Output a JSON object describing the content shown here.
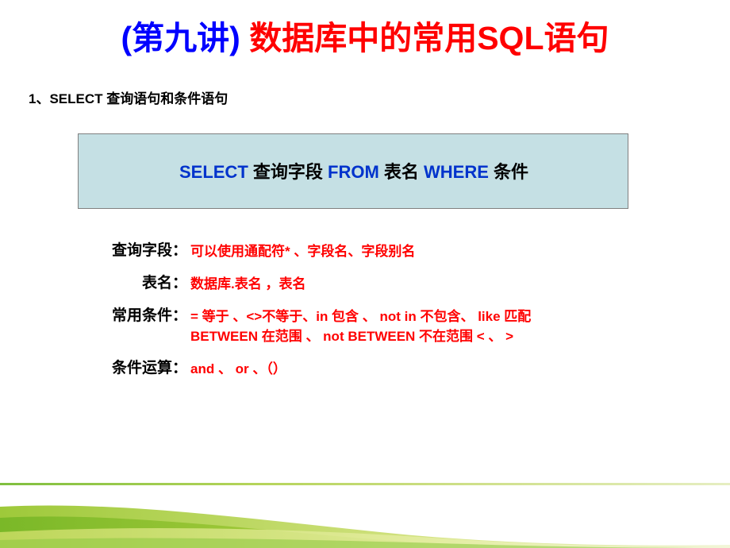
{
  "slide": {
    "title_parts": [
      {
        "text": "(第九讲)",
        "color": "#0000ff"
      },
      {
        "text": " 数据库中的常用",
        "color": "#ff0000"
      },
      {
        "text": "SQL",
        "color": "#ff0000"
      },
      {
        "text": "语句",
        "color": "#ff0000"
      }
    ],
    "title_plain": "(第九讲) 数据库中的常用SQL语句",
    "heading": "1、SELECT 查询语句和条件语句",
    "syntax_box": {
      "segments": [
        {
          "text": "SELECT",
          "color": "#0033cc"
        },
        {
          "text": "  查询字段 ",
          "color": "#000000"
        },
        {
          "text": "FROM",
          "color": "#0033cc"
        },
        {
          "text": " 表名 ",
          "color": "#000000"
        },
        {
          "text": "WHERE",
          "color": "#0033cc"
        },
        {
          "text": " 条件",
          "color": "#000000"
        }
      ],
      "plain": "SELECT  查询字段 FROM 表名 WHERE 条件",
      "fill_color": "#c5e0e4",
      "border_color": "#808080"
    },
    "definitions": [
      {
        "label": "查询字段：",
        "value_line1": "可以使用通配符* 、字段名、字段别名",
        "value_line2": ""
      },
      {
        "label": "表名：",
        "value_line1": "数据库.表名 ，表名",
        "value_line2": ""
      },
      {
        "label": "常用条件：",
        "value_line1": "= 等于 、<>不等于、in 包含 、 not in 不包含、 like 匹配",
        "value_line2": "BETWEEN  在范围 、 not BETWEEN  不在范围  <  、 >"
      },
      {
        "label": "条件运算：",
        "value_line1": "and 、 or 、（）",
        "value_line2": ""
      }
    ],
    "accent_colors": {
      "title_blue": "#0000ff",
      "title_red": "#ff0000",
      "keyword_blue": "#0033cc",
      "value_red": "#ff0000",
      "box_fill": "#c5e0e4",
      "band_green": "#8cc63f"
    }
  }
}
